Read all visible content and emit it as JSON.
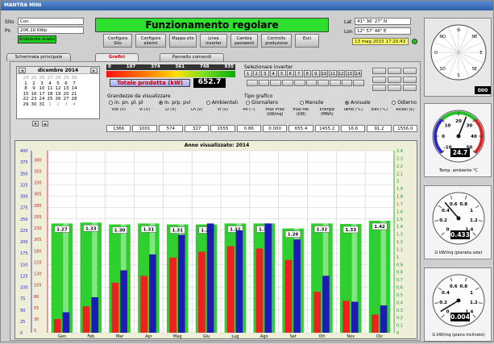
{
  "window_title": "MANTRA MINI",
  "site": {
    "sito_label": "Sito",
    "sito_value": "Con",
    "pot_label": "Pn",
    "pot_value": "206.10 KWp",
    "status_box": "Ambiente arabo"
  },
  "status_text": "Funzionamento regolare",
  "toolbar": [
    {
      "name": "configura-sito-button",
      "label": "Configura Sito"
    },
    {
      "name": "configura-allarmi-button",
      "label": "Configura allarmi"
    },
    {
      "name": "mappa-sito-button",
      "label": "Mappa sito"
    },
    {
      "name": "linea-inverter-button",
      "label": "Linea inverter"
    },
    {
      "name": "cambia-password-button",
      "label": "Cambia password"
    },
    {
      "name": "controllo-produzione-button",
      "label": "Controllo produzione"
    },
    {
      "name": "esci-button",
      "label": "Esci"
    }
  ],
  "coords": {
    "lat_label": "Lat",
    "lat_value": "41° 36' 27\" N",
    "lon_label": "Lon",
    "lon_value": "12° 57' 46\" E",
    "datetime": "13 mag 2015 17:20:43"
  },
  "tabs": [
    "Schermata principale",
    "Grafici",
    "Pannello comandi"
  ],
  "calendar": {
    "month": "dicembre 2014",
    "rows": [
      [
        "24",
        "25",
        "26",
        "27",
        "28",
        "29",
        "30"
      ],
      [
        "1",
        "2",
        "3",
        "4",
        "5",
        "6",
        "7"
      ],
      [
        "8",
        "9",
        "10",
        "11",
        "12",
        "13",
        "14"
      ],
      [
        "15",
        "16",
        "17",
        "18",
        "19",
        "20",
        "21"
      ],
      [
        "22",
        "23",
        "24",
        "25",
        "26",
        "27",
        "28"
      ],
      [
        "29",
        "30",
        "31",
        "1",
        "2",
        "3",
        "4"
      ]
    ]
  },
  "power_scale": {
    "ticks": [
      "0",
      "187",
      "374",
      "561",
      "748",
      "935"
    ],
    "caption": "Totale prodotta (kW)",
    "value": "652.7"
  },
  "viz": {
    "title": "Grandezze da visualizzare",
    "options": [
      "in. pn. pl. pl",
      "in. prp. pvl",
      "Ambientali"
    ]
  },
  "chart_type": {
    "title": "Tipo grafico",
    "options": [
      "Giornaliero",
      "Mensile",
      "Annuale",
      "Odierno"
    ]
  },
  "inverter_title": "Selezionare inverter",
  "inverter_buttons": [
    "1",
    "2",
    "3",
    "4",
    "5",
    "6",
    "7",
    "8",
    "9",
    "10",
    "11",
    "12",
    "13",
    "14"
  ],
  "values_table": {
    "headers": [
      "Vdc (V)",
      "Vl (V)",
      "Lt (V)",
      "Ln (V)",
      "Vl (V)",
      "PR (--)",
      "max Irrad (kW/mq)",
      "max Pac (kW)",
      "Energia (MWh)",
      "Tamb (°C)",
      "Tcell (°C)",
      "Ricavi (€)"
    ],
    "values": [
      "1366",
      "1001",
      "574",
      "327",
      "1555",
      "0.86",
      "0.000",
      "655.4",
      "1455.2",
      "16.6",
      "91.2",
      "1556.0"
    ]
  },
  "chart_data": {
    "type": "bar",
    "title": "Anno visualizzato: 2014",
    "left_axis_1": [
      "400",
      "375",
      "350",
      "325",
      "300",
      "275",
      "250",
      "225",
      "200",
      "175",
      "150",
      "125",
      "100",
      "75",
      "50",
      "25",
      "0"
    ],
    "left_axis_2": [
      "380",
      "355",
      "330",
      "305",
      "280",
      "255",
      "230",
      "205",
      "180",
      "155",
      "130",
      "105",
      "80",
      "55",
      "30",
      "5"
    ],
    "right_axis": [
      "2.4",
      "2.3",
      "2.2",
      "2.1",
      "2",
      "1.9",
      "1.8",
      "1.7",
      "1.6",
      "1.5",
      "1.4",
      "1.3",
      "1.2",
      "1.1",
      "1",
      "0.9",
      "0.8",
      "0.7",
      "0.6",
      "0.5",
      "0.4",
      "0.3",
      "0.2",
      "0.1",
      "0"
    ],
    "categories": [
      "Gen",
      "Feb",
      "Mar",
      "Apr",
      "Mag",
      "Giu",
      "Lug",
      "Ago",
      "Set",
      "Ott",
      "Nov",
      "Dic"
    ],
    "ylim": [
      0,
      400
    ],
    "green": [
      240,
      242,
      238,
      240,
      238,
      238,
      240,
      240,
      229,
      240,
      239,
      246
    ],
    "green_labels": [
      "1.27",
      "1.33",
      "1.30",
      "1.31",
      "1.31",
      "1.29",
      "1.32",
      "1.32",
      "1.26",
      "1.32",
      "1.33",
      "1.42"
    ],
    "red": [
      30,
      58,
      110,
      125,
      165,
      178,
      190,
      185,
      160,
      90,
      70,
      40
    ],
    "blue": [
      45,
      78,
      137,
      172,
      215,
      240,
      225,
      240,
      205,
      125,
      68,
      60
    ],
    "green_color": "#2ecf2e",
    "red_color": "#ee2020",
    "blue_color": "#1c1cb4"
  },
  "gauges": [
    {
      "caption": "Temp. ambiente °C",
      "value": "24.7",
      "ticks": [
        "-10",
        "0",
        "10",
        "20",
        "30",
        "40",
        "50"
      ]
    },
    {
      "caption": "G kW/mq (pianeta sole)",
      "value": "0.433",
      "ticks": [
        "0",
        "0.2",
        "0.4",
        "0.6",
        "0.8",
        "1",
        "1.2",
        "1.4"
      ]
    },
    {
      "caption": "G kW/mq (piano inclinato)",
      "value": "0.004",
      "ticks": [
        "0",
        "0.2",
        "0.4",
        "0.6",
        "0.8",
        "1",
        "1.2",
        "1.4"
      ]
    }
  ],
  "compass": {
    "labels": [
      "N",
      "NE",
      "E",
      "SE",
      "S",
      "SO",
      "O",
      "NO"
    ],
    "readout": "000"
  }
}
